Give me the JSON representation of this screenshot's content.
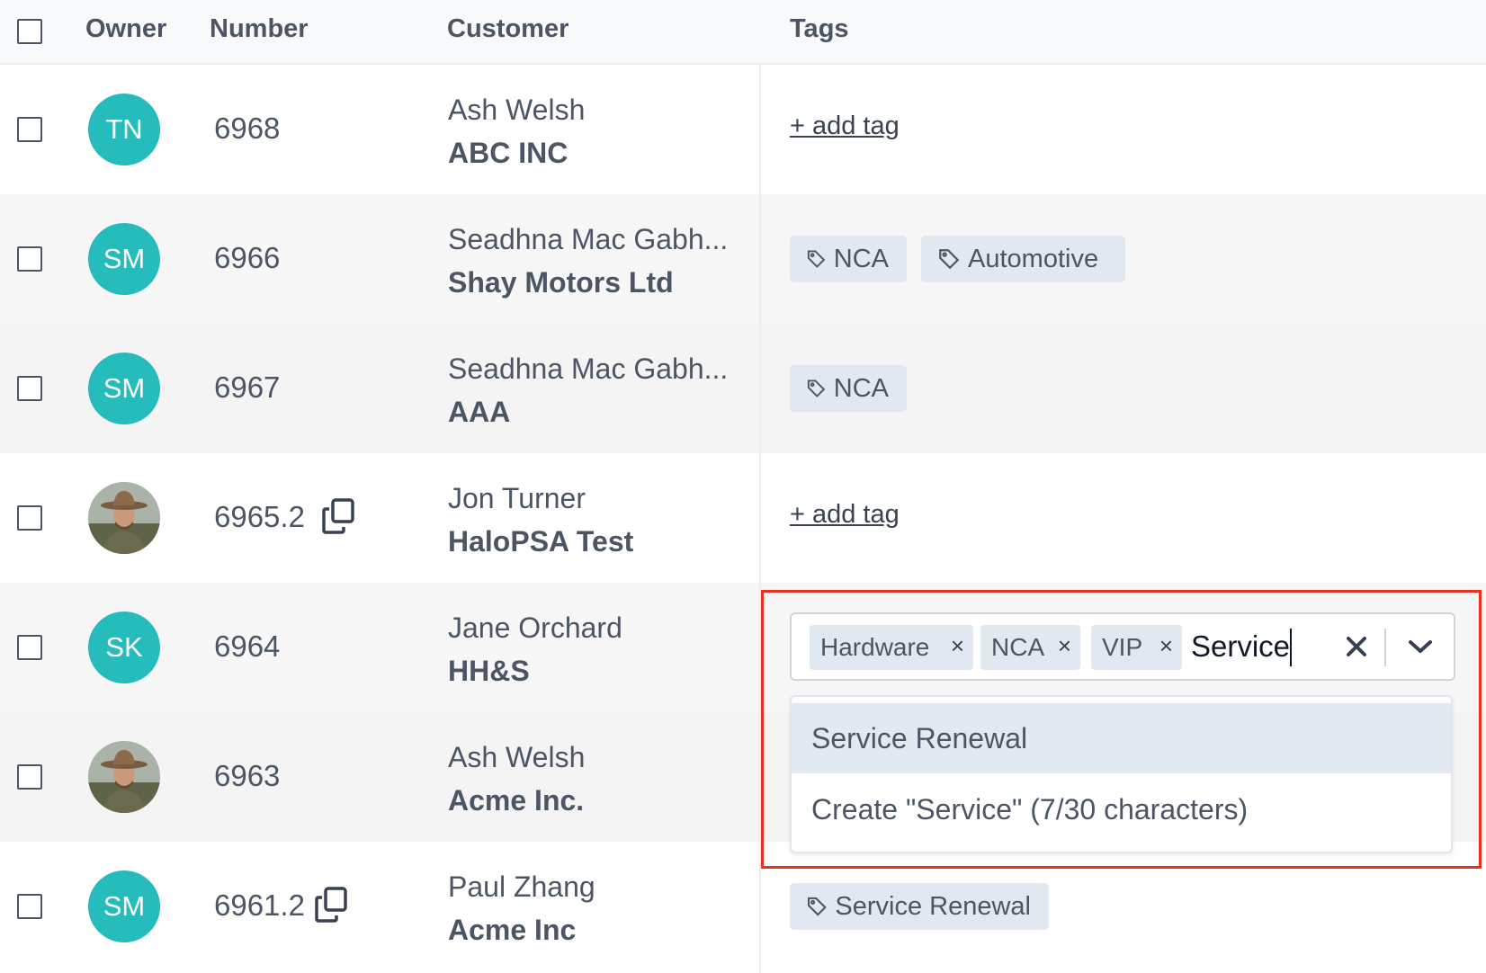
{
  "table": {
    "headers": {
      "owner": "Owner",
      "number": "Number",
      "customer": "Customer",
      "tags": "Tags"
    },
    "rows": [
      {
        "owner_initials": "TN",
        "number": "6968",
        "person": "Ash Welsh",
        "company": "ABC INC",
        "add_tag": "+ add tag",
        "tags": []
      },
      {
        "owner_initials": "SM",
        "number": "6966",
        "person": "Seadhna Mac Gabh...",
        "company": "Shay Motors Ltd",
        "tags": [
          "NCA",
          "Automotive"
        ]
      },
      {
        "owner_initials": "SM",
        "number": "6967",
        "person": "Seadhna Mac Gabh...",
        "company": "AAA",
        "tags": [
          "NCA"
        ]
      },
      {
        "owner_initials": "",
        "number": "6965.2",
        "person": "Jon Turner",
        "company": "HaloPSA Test",
        "add_tag": "+ add tag",
        "tags": []
      },
      {
        "owner_initials": "SK",
        "number": "6964",
        "person": "Jane Orchard",
        "company": "HH&S",
        "tags": []
      },
      {
        "owner_initials": "",
        "number": "6963",
        "person": "Ash Welsh",
        "company": "Acme Inc.",
        "tags": []
      },
      {
        "owner_initials": "SM",
        "number": "6961.2",
        "person": "Paul Zhang",
        "company": "Acme Inc",
        "tags": [
          "Service Renewal"
        ]
      }
    ]
  },
  "tag_editor": {
    "selected": [
      "Hardware",
      "NCA",
      "VIP"
    ],
    "remove_glyph": "×",
    "input_value": "Service",
    "options": [
      "Service Renewal",
      "Create \"Service\" (7/30 characters)"
    ]
  },
  "colors": {
    "avatar": "#26bcbc",
    "tag_bg": "#e2e8ef",
    "highlight_border": "#e8321e",
    "active_option": "#e3e9f0"
  },
  "icons": {
    "tag": "tag-icon",
    "copy": "copy-icon",
    "clear": "close-icon",
    "dropdown": "chevron-down-icon"
  }
}
